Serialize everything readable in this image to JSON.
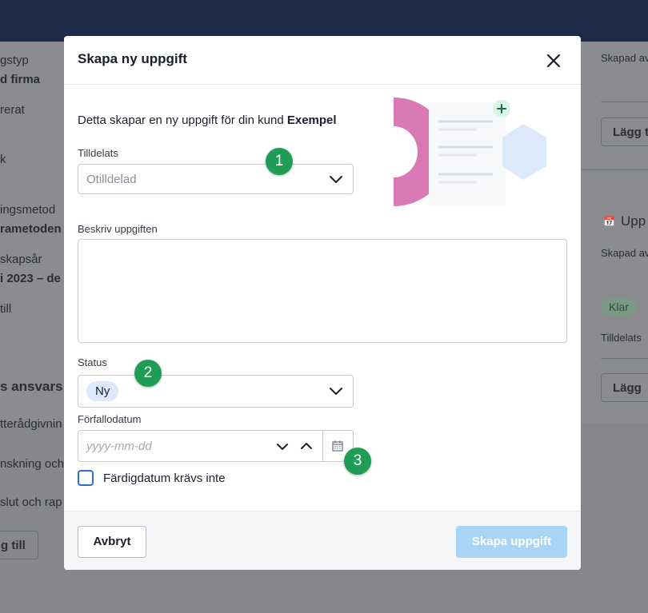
{
  "background": {
    "left_fragments": [
      "gstyp",
      "d firma",
      "rerat",
      "k",
      "ingsmetod",
      "rametoden",
      "skapsår",
      "i 2023 – de",
      "till",
      "s ansvars",
      "tterådgivnin",
      "nskning och",
      "slut och rap"
    ],
    "left_button": "g till",
    "right_skapad_top": "Skapad av",
    "right_button_top": "Lägg t",
    "right_heading": "Upp",
    "right_skapad": "Skapad av",
    "right_badge": "Klar",
    "right_tilldelats": "Tilldelats",
    "right_button_bottom": "Lägg"
  },
  "modal": {
    "title": "Skapa ny uppgift",
    "intro_text": "Detta skapar en ny uppgift för din kund",
    "customer_name": "Exempel",
    "assignee": {
      "label": "Tilldelats",
      "value": "Otilldelad"
    },
    "description": {
      "label": "Beskriv uppgiften",
      "value": ""
    },
    "status": {
      "label": "Status",
      "value": "Ny"
    },
    "due_date": {
      "label": "Förfallodatum",
      "placeholder": "yyyy-mm-dd"
    },
    "no_completion_date": {
      "label": "Färdigdatum krävs inte",
      "checked": false
    },
    "cancel_button": "Avbryt",
    "create_button": "Skapa uppgift"
  },
  "markers": [
    "1",
    "2",
    "3"
  ],
  "colors": {
    "topbar": "#1d2a49",
    "marker": "#1f9d55",
    "create_button": "#a9d4f5",
    "status_pill": "#dbe9f8",
    "checkbox_border": "#2b6fd6"
  }
}
